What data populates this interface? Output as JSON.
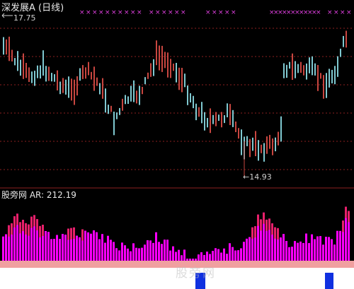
{
  "title": "深发展A (日线)",
  "high_marker": "17.75",
  "low_marker": "←14.93",
  "indicator": {
    "brand": "股旁网",
    "label": "AR:",
    "value": "212.19"
  },
  "watermark": "股旁网",
  "colors": {
    "background": "#000000",
    "up_candle": "#c84640",
    "down_candle": "#7fc8d0",
    "grid": "#8b2020",
    "marker": "#e040e0",
    "bar_main": "#ff00ff",
    "bar_peak": "#e8206a",
    "salmon_band": "#f0a0a0",
    "white_band": "#ffffff",
    "blue_bar": "#1030e0"
  },
  "chart_data": {
    "type": "candlestick",
    "title": "深发展A (日线)",
    "high": 17.75,
    "low": 14.93,
    "indicator": {
      "name": "AR",
      "value": 212.19,
      "type": "bar"
    }
  }
}
